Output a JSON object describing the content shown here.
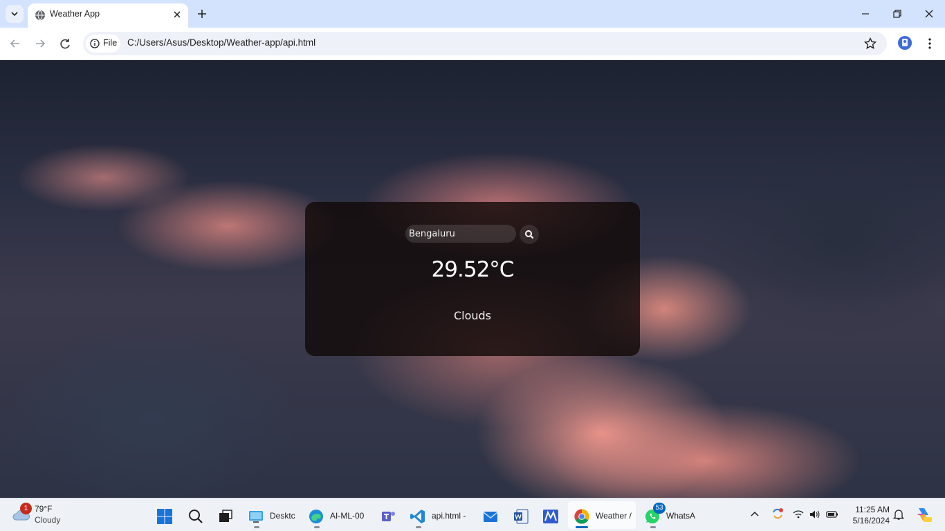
{
  "browser": {
    "tab_title": "Weather App",
    "url_scheme_label": "File",
    "url": "C:/Users/Asus/Desktop/Weather-app/api.html"
  },
  "weather_card": {
    "search_value": "Bengaluru",
    "temperature": "29.52°C",
    "description": "Clouds"
  },
  "taskbar": {
    "weather_widget": {
      "temp": "79°F",
      "condition": "Cloudy",
      "badge": "1"
    },
    "apps": [
      {
        "name": "start",
        "label": ""
      },
      {
        "name": "search",
        "label": ""
      },
      {
        "name": "task-view",
        "label": ""
      },
      {
        "name": "file-explorer",
        "label": "Desktc"
      },
      {
        "name": "edge",
        "label": "AI-ML-00"
      },
      {
        "name": "teams",
        "label": ""
      },
      {
        "name": "vscode",
        "label": "api.html -"
      },
      {
        "name": "mail",
        "label": ""
      },
      {
        "name": "word",
        "label": ""
      },
      {
        "name": "app-m",
        "label": ""
      },
      {
        "name": "chrome",
        "label": "Weather /"
      },
      {
        "name": "whatsapp",
        "label": "WhatsA",
        "badge": "53"
      }
    ],
    "clock": {
      "time": "11:25 AM",
      "date": "5/16/2024"
    }
  },
  "colors": {
    "titlebar": "#d3e3fd",
    "card_bg": "rgba(18,10,8,0.82)",
    "accent": "#0067c0"
  }
}
